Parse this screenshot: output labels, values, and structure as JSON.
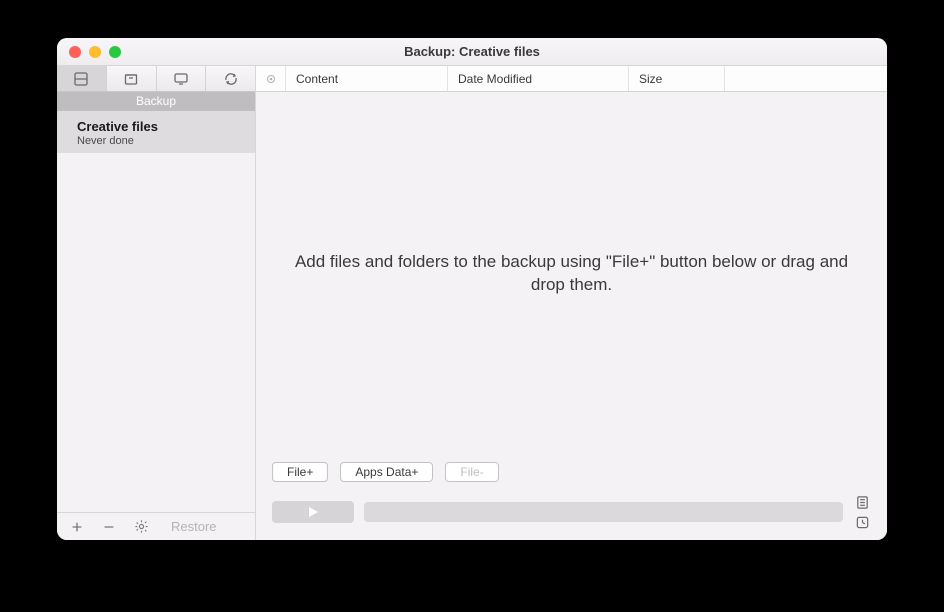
{
  "window": {
    "title": "Backup: Creative files"
  },
  "sidebar": {
    "section_label": "Backup",
    "item": {
      "name": "Creative files",
      "status": "Never done"
    },
    "footer": {
      "restore_label": "Restore"
    }
  },
  "main": {
    "columns": {
      "content": "Content",
      "date_modified": "Date Modified",
      "size": "Size"
    },
    "empty_message": "Add files and folders to the backup using \"File+\" button below or drag and drop them.",
    "buttons": {
      "file_add": "File+",
      "apps_data_add": "Apps Data+",
      "file_remove": "File-"
    }
  }
}
